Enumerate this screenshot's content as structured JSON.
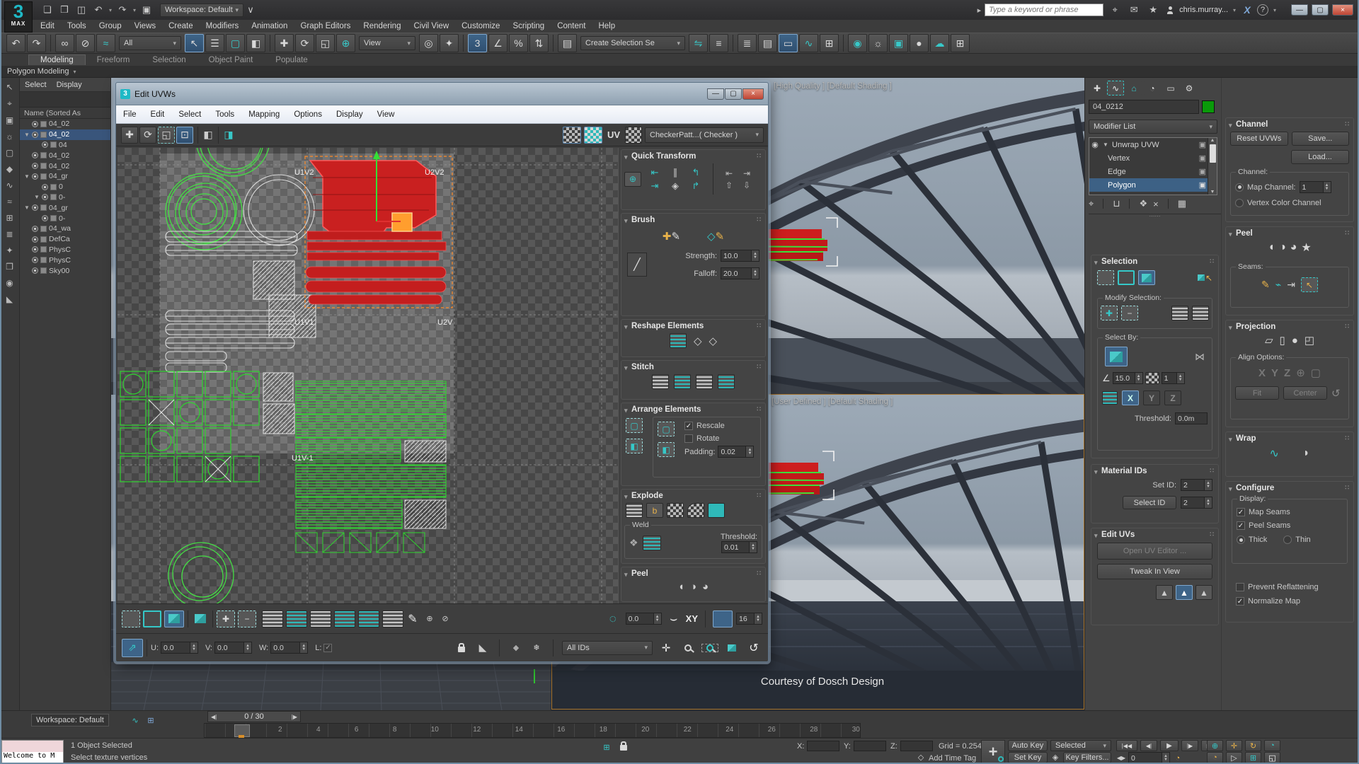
{
  "icons": {
    "caret": "▾",
    "vee": "∨",
    "min": "—",
    "max": "▢",
    "close": "×",
    "arrow": "▸",
    "binoc": "⌖",
    "mail": "✉",
    "star": "★",
    "exchange": "X",
    "help": "?",
    "new": "❏",
    "open": "❒",
    "save": "◫",
    "undo": "↶",
    "redo": "↷",
    "proj": "▣",
    "link": "∞",
    "unlink": "⊘",
    "bindsw": "≈",
    "cursor": "↖",
    "byname": "☰",
    "region": "▢",
    "wincross": "◧",
    "move": "✚",
    "rot": "⟳",
    "scale": "◱",
    "pivot": "◎",
    "manip": "⊕",
    "kb": "✦",
    "snap3": "3",
    "snapa": "∠",
    "snapp": "%",
    "snaps": "⇅",
    "nsel": "▤",
    "mirror": "⇋",
    "align": "≡",
    "layers": "≣",
    "ribbon": "▭",
    "curve": "∿",
    "schem": "⊞",
    "mated": "◉",
    "rset": "☼",
    "rfw": "▣",
    "rprod": "●",
    "cloud": "☁",
    "uvfree": "⊡",
    "mirl": "◧",
    "mirr": "◨",
    "pencil": "✎",
    "plus": "✚",
    "minus": "−",
    "circ": "◌",
    "curv": "⌣",
    "filt": "◣",
    "hide": "◆",
    "frz": "❄",
    "pan": "✛",
    "back": "↺",
    "dots": "∷",
    "eye": "◉",
    "cubei": "▣",
    "arrR": "▶",
    "arrD": "▼",
    "tag": "◇",
    "clock": "◔",
    "keyico": "◈",
    "stepLR": "◀▶",
    "pstart": "|◀◀",
    "pprev": "◀|",
    "play": "▶",
    "pnext": "|▶",
    "pend": "▶▶|",
    "navzoom": "⊕",
    "navall": "⊞",
    "navpan": "✛",
    "navfov": "◔",
    "navtime": "◔",
    "navsel": "▷",
    "navorbit": "↻",
    "navmax": "◱",
    "q1": "⊕",
    "q2": "⇤",
    "q3": "∥",
    "q4": "↰",
    "q5": "⇥",
    "q6": "↱",
    "q7": "⇧",
    "q8": "⇩",
    "q9": "◈",
    "bmove": "✚",
    "bcube": "◇",
    "line": "╱",
    "t1": "✚",
    "t2": "∿",
    "t3": "⌂",
    "t4": "◔",
    "t5": "▭",
    "t6": "⚙",
    "pin": "⌖",
    "tube": "⊔",
    "uniq": "❖",
    "trash": "×",
    "cfg": "▦",
    "node": "⋈",
    "angle": "∠",
    "selel": "↖",
    "pl1": "▱",
    "pl2": "▯",
    "pl3": "●",
    "pl4": "◰",
    "w1": "∿",
    "w2": "◗",
    "e1": "▲",
    "e2": "▲",
    "e3": "▲",
    "pe1": "◖",
    "pe2": "◑",
    "pe3": "◕",
    "pe4": "★",
    "s1": "✎",
    "s2": "⌁",
    "s3": "⇥",
    "s4": "↖"
  },
  "app": {
    "workspace": "Workspace: Default",
    "search_placeholder": "Type a keyword or phrase",
    "user": "chris.murray...",
    "menus": [
      "Edit",
      "Tools",
      "Group",
      "Views",
      "Create",
      "Modifiers",
      "Animation",
      "Graph Editors",
      "Rendering",
      "Civil View",
      "Customize",
      "Scripting",
      "Content",
      "Help"
    ],
    "all": "All",
    "view": "View",
    "create_sel": "Create Selection Se",
    "ribbon_tabs": [
      "Modeling",
      "Freeform",
      "Selection",
      "Object Paint",
      "Populate"
    ],
    "ribbon_sub": "Polygon Modeling"
  },
  "explorer": {
    "menus": [
      "Select",
      "Display"
    ],
    "header": "Name (Sorted As",
    "items": [
      {
        "a": "",
        "n": "04_02"
      },
      {
        "a": "▼",
        "n": "04_02"
      },
      {
        "a": "",
        "n": "04"
      },
      {
        "a": "",
        "n": "04_02"
      },
      {
        "a": "",
        "n": "04_02"
      },
      {
        "a": "▼",
        "n": "04_gr"
      },
      {
        "a": "",
        "n": "0"
      },
      {
        "a": "▼",
        "n": "0-"
      },
      {
        "a": "▼",
        "n": "04_gr"
      },
      {
        "a": "",
        "n": "0-"
      },
      {
        "a": "",
        "n": "04_wa"
      },
      {
        "a": "",
        "n": "DefCa"
      },
      {
        "a": "",
        "n": "PhysC"
      },
      {
        "a": "",
        "n": "PhysC"
      },
      {
        "a": "",
        "n": "Sky00"
      }
    ]
  },
  "uvw": {
    "title": "Edit UVWs",
    "menus": [
      "File",
      "Edit",
      "Select",
      "Tools",
      "Mapping",
      "Options",
      "Display",
      "View"
    ],
    "uv": "UV",
    "map_dd": "CheckerPatt...( Checker )",
    "labels": {
      "a": "U1V2",
      "b": "U2V2",
      "c": "U1V1",
      "d": "U2V",
      "e": "U1V-1"
    },
    "qt": "Quick Transform",
    "brush": {
      "t": "Brush",
      "sl": "Strength:",
      "sv": "10.0",
      "fl": "Falloff:",
      "fv": "20.0"
    },
    "reshape": "Reshape Elements",
    "stitch": "Stitch",
    "arr": {
      "t": "Arrange Elements",
      "rescale": "Rescale",
      "rotate": "Rotate",
      "pl": "Padding:",
      "pv": "0.02"
    },
    "exp": {
      "t": "Explode",
      "weld": "Weld",
      "tl": "Threshold:",
      "tv": "0.01"
    },
    "peel": "Peel",
    "b": {
      "ul": "U:",
      "u": "0.0",
      "vl": "V:",
      "v": "0.0",
      "wl": "W:",
      "w": "0.0",
      "ll": "L:",
      "soft": "0.0",
      "xy": "XY",
      "grid": "16",
      "ids": "All IDs"
    }
  },
  "viewports": {
    "top_label": "[High Quality ]  [Default Shading ]",
    "bottom_label": "[User Defined ]  [Default Shading ]",
    "credit": "Courtesy of Dosch Design"
  },
  "cmd": {
    "name": "04_0212",
    "modifier_list": "Modifier List",
    "stack": [
      "Unwrap UVW",
      "Vertex",
      "Edge",
      "Polygon"
    ],
    "sel": {
      "t": "Selection",
      "modify": "Modify Selection:",
      "by": "Select By:",
      "angle": "15.0",
      "mat": "1",
      "x": "X",
      "y": "Y",
      "z": "Z",
      "th_l": "Threshold:",
      "th": "0.0m"
    },
    "mat": {
      "t": "Material IDs",
      "set_l": "Set ID:",
      "set": "2",
      "btn": "Select ID",
      "sel": "2"
    },
    "euv": {
      "t": "Edit UVs",
      "open": "Open UV Editor ...",
      "tweak": "Tweak In View"
    },
    "chan": {
      "t": "Channel",
      "reset": "Reset UVWs",
      "save": "Save...",
      "load": "Load...",
      "grp": "Channel:",
      "map_l": "Map Channel:",
      "map": "1",
      "vc": "Vertex Color Channel"
    },
    "peel": {
      "t": "Peel",
      "seams": "Seams:"
    },
    "proj": {
      "t": "Projection",
      "align": "Align Options:",
      "x": "X",
      "y": "Y",
      "z": "Z",
      "fit": "Fit",
      "center": "Center"
    },
    "wrap": {
      "t": "Wrap"
    },
    "conf": {
      "t": "Configure",
      "disp": "Display:",
      "ms": "Map Seams",
      "ps": "Peel Seams",
      "thick": "Thick",
      "thin": "Thin",
      "prev": "Prevent Reflattening",
      "norm": "Normalize Map"
    }
  },
  "track": {
    "workspace": "Workspace: Default",
    "slider": "0 / 30",
    "labels": [
      "2",
      "4",
      "6",
      "8",
      "10",
      "12",
      "14",
      "16",
      "18",
      "20",
      "22",
      "24",
      "26",
      "28",
      "30"
    ]
  },
  "status": {
    "listener": "Welcome to M",
    "l1": "1 Object Selected",
    "l2": "Select texture vertices",
    "x": "X:",
    "y": "Y:",
    "z": "Z:",
    "grid": "Grid = 0.254m",
    "tag": "Add Time Tag",
    "autokey": "Auto Key",
    "setkey": "Set Key",
    "seldd": "Selected",
    "filters": "Key Filters...",
    "frame": "0"
  }
}
